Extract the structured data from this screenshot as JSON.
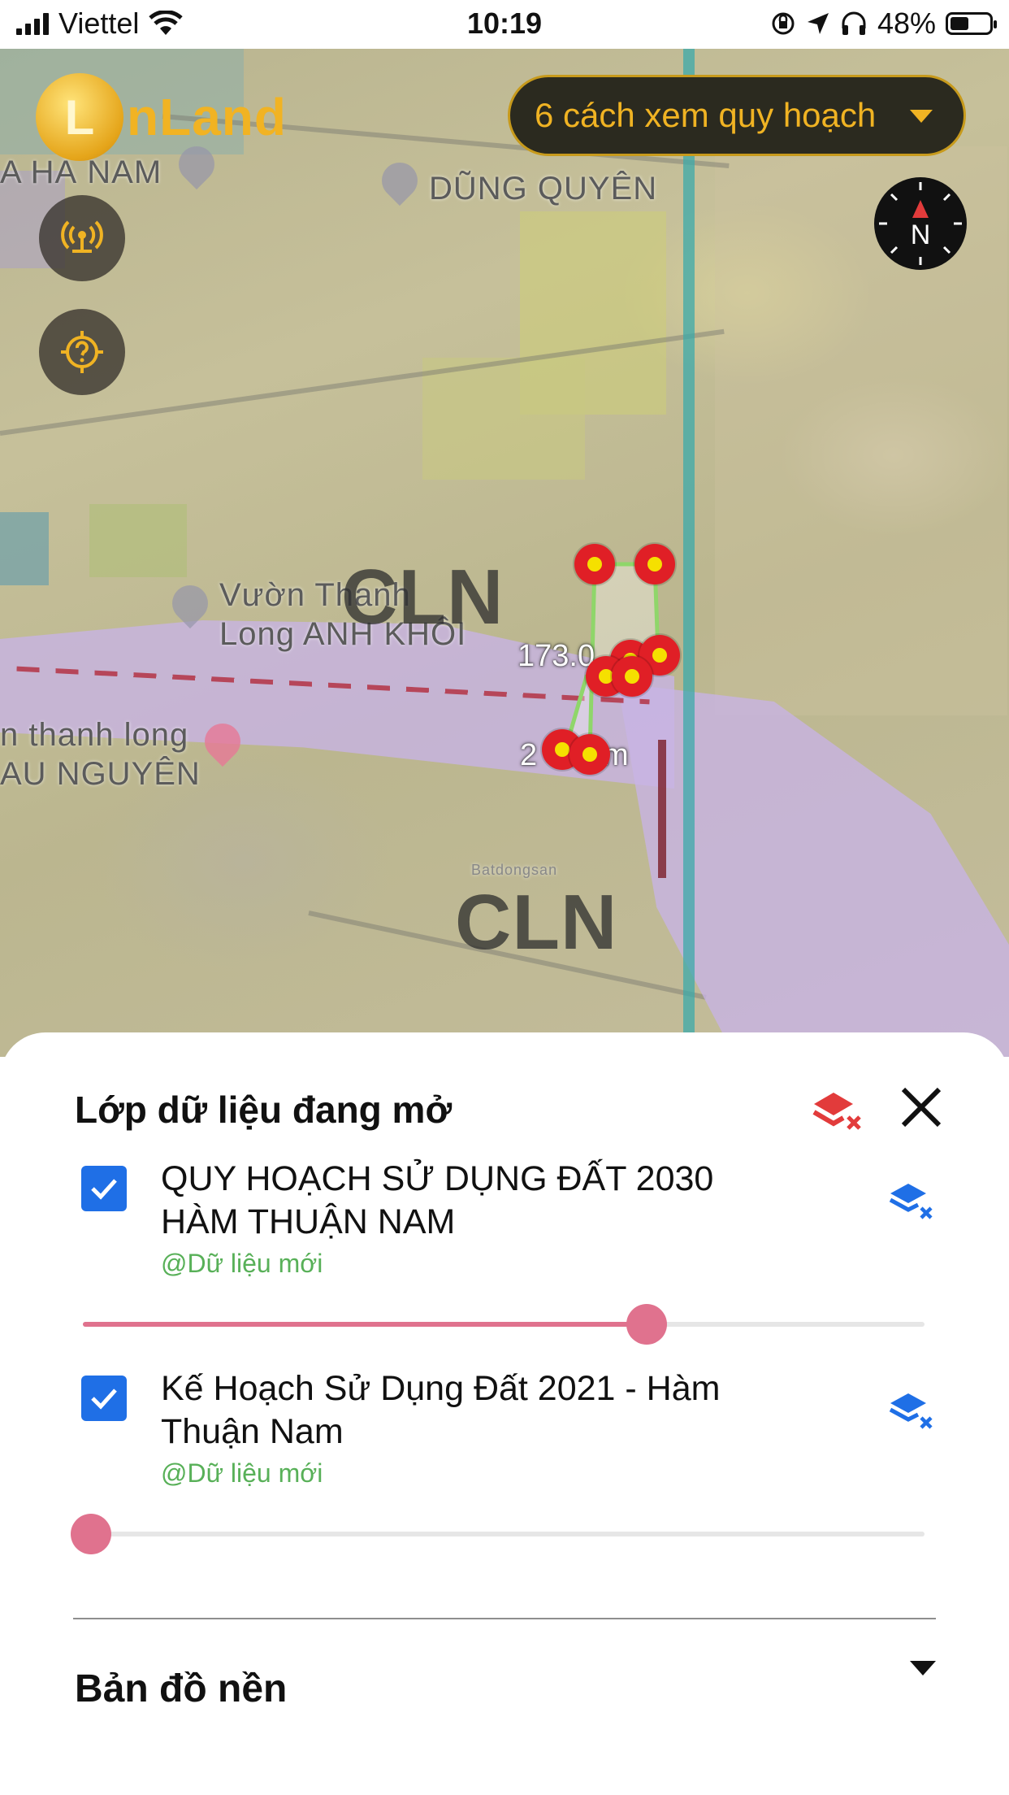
{
  "status_bar": {
    "carrier": "Viettel",
    "time": "10:19",
    "battery": "48%",
    "battery_level": 0.48
  },
  "map": {
    "labels": [
      "A HÀ NAM",
      "DŨNG QUYÊN",
      "Vườn Thanh",
      "Long ANH KHÔI",
      "n thanh long",
      "AU NGUYÊN",
      "Batdongsan"
    ],
    "zone_codes": [
      "CLN",
      "CLN"
    ],
    "dimensions": [
      "173.0",
      "2",
      "m"
    ]
  },
  "top_controls": {
    "logo_text": "nLand",
    "logo_letter": "L",
    "plan_button_label": "6 cách xem quy hoạch",
    "compass_label": "N"
  },
  "sheet": {
    "title": "Lớp dữ liệu đang mở",
    "layers": [
      {
        "name": "QUY HOẠCH SỬ DỤNG ĐẤT 2030 HÀM THUẬN NAM",
        "source": "@Dữ liệu mới",
        "checked": true,
        "opacity": 0.67
      },
      {
        "name": "Kế Hoạch Sử Dụng Đất 2021 - Hàm Thuận Nam",
        "source": "@Dữ liệu mới",
        "checked": true,
        "opacity": 0.0
      }
    ],
    "basemap_label": "Bản đồ nền"
  },
  "colors": {
    "accent_gold": "#f0b323",
    "checkbox_blue": "#1f6fe6",
    "slider_pink": "#e0728e",
    "marker_red": "#e01f26",
    "source_green": "#58b058"
  }
}
